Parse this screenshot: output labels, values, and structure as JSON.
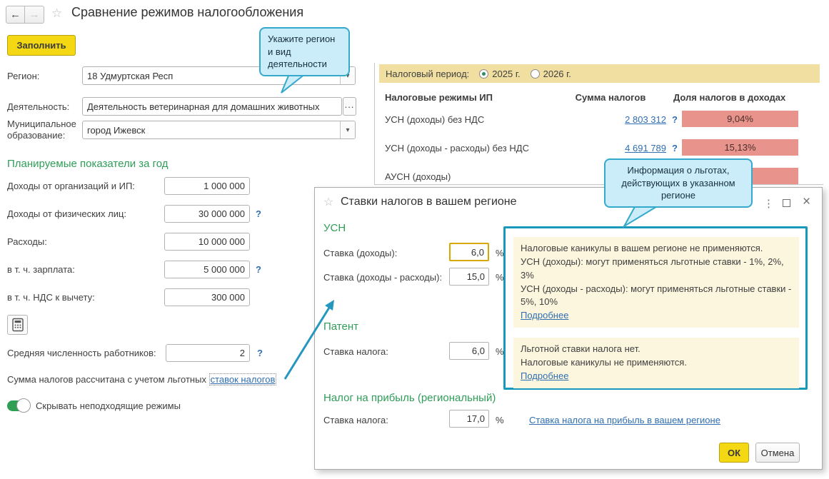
{
  "window": {
    "title": "Сравнение режимов налогообложения",
    "back": "←",
    "forward": "→",
    "star": "☆"
  },
  "form": {
    "fill_button": "Заполнить",
    "region": {
      "label": "Регион:",
      "value": "18 Удмуртская Респ"
    },
    "activity": {
      "label": "Деятельность:",
      "value": "Деятельность ветеринарная для домашних животных",
      "more": "..."
    },
    "municipality": {
      "label": "Муниципальное образование:",
      "value": "город Ижевск"
    },
    "planned_header": "Планируемые показатели за год",
    "rows": [
      {
        "label": "Доходы от организаций и ИП:",
        "value": "1 000 000",
        "help": ""
      },
      {
        "label": "Доходы от физических лиц:",
        "value": "30 000 000",
        "help": "?"
      },
      {
        "label": "Расходы:",
        "value": "10 000 000",
        "help": ""
      },
      {
        "label": "в т. ч. зарплата:",
        "value": "5 000 000",
        "help": "?"
      },
      {
        "label": "в т. ч. НДС к вычету:",
        "value": "300 000",
        "help": ""
      }
    ],
    "employees": {
      "label": "Средняя численность работников:",
      "value": "2",
      "help": "?"
    },
    "benefit_note": {
      "text": "Сумма налогов рассчитана с учетом льготных",
      "link": "ставок налогов"
    },
    "toggle_label": "Скрывать неподходящие режимы"
  },
  "panel": {
    "period_label": "Налоговый период:",
    "periods": [
      {
        "label": "2025 г."
      },
      {
        "label": "2026 г."
      }
    ],
    "columns": [
      "Налоговые режимы ИП",
      "Сумма налогов",
      "Доля налогов в доходах"
    ],
    "rows": [
      {
        "name": "УСН (доходы) без НДС",
        "amount": "2 803 312",
        "help": "?",
        "share": "9,04%"
      },
      {
        "name": "УСН (доходы - расходы) без НДС",
        "amount": "4 691 789",
        "help": "?",
        "share": "15,13%"
      },
      {
        "name": "АУСН (доходы)",
        "amount": "",
        "help": "",
        "share": ""
      }
    ]
  },
  "tooltips": {
    "region_hint": "Укажите регион и вид деятельности",
    "benefits_hint": "Информация о льготах, действующих в указанном регионе"
  },
  "dialog": {
    "title": "Ставки налогов в вашем регионе",
    "usn_header": "УСН",
    "usn_rows": [
      {
        "label": "Ставка (доходы):",
        "value": "6,0",
        "unit": "%"
      },
      {
        "label": "Ставка (доходы - расходы):",
        "value": "15,0",
        "unit": "%"
      }
    ],
    "patent_header": "Патент",
    "patent_row": {
      "label": "Ставка налога:",
      "value": "6,0",
      "unit": "%"
    },
    "profit_header": "Налог на прибыль (региональный)",
    "profit_row": {
      "label": "Ставка налога:",
      "value": "17,0",
      "unit": "%"
    },
    "profit_link": "Ставка налога на прибыль в вашем регионе",
    "info_box1": {
      "lines": [
        "Налоговые каникулы в вашем регионе не применяются.",
        "УСН (доходы): могут применяться льготные ставки - 1%, 2%, 3%",
        "УСН (доходы - расходы): могут применяться льготные ставки - 5%, 10%"
      ],
      "link": "Подробнее"
    },
    "info_box2": {
      "lines": [
        "Льготной ставки налога нет.",
        "Налоговые каникулы не применяются."
      ],
      "link": "Подробнее"
    },
    "ok": "ОК",
    "cancel": "Отмена"
  },
  "colors": {
    "accent_yellow": "#F3D813",
    "period_bar": "#F0DFA1",
    "bar_red": "#E8938B",
    "green_header": "#2E9E57",
    "toggle_green": "#2D9E53",
    "tooltip_fill": "#CBEDF9",
    "tooltip_border": "#35A9CB",
    "info_border": "#1898BA",
    "info_fill": "#FCF6DE",
    "link_blue": "#2F6FB2"
  }
}
